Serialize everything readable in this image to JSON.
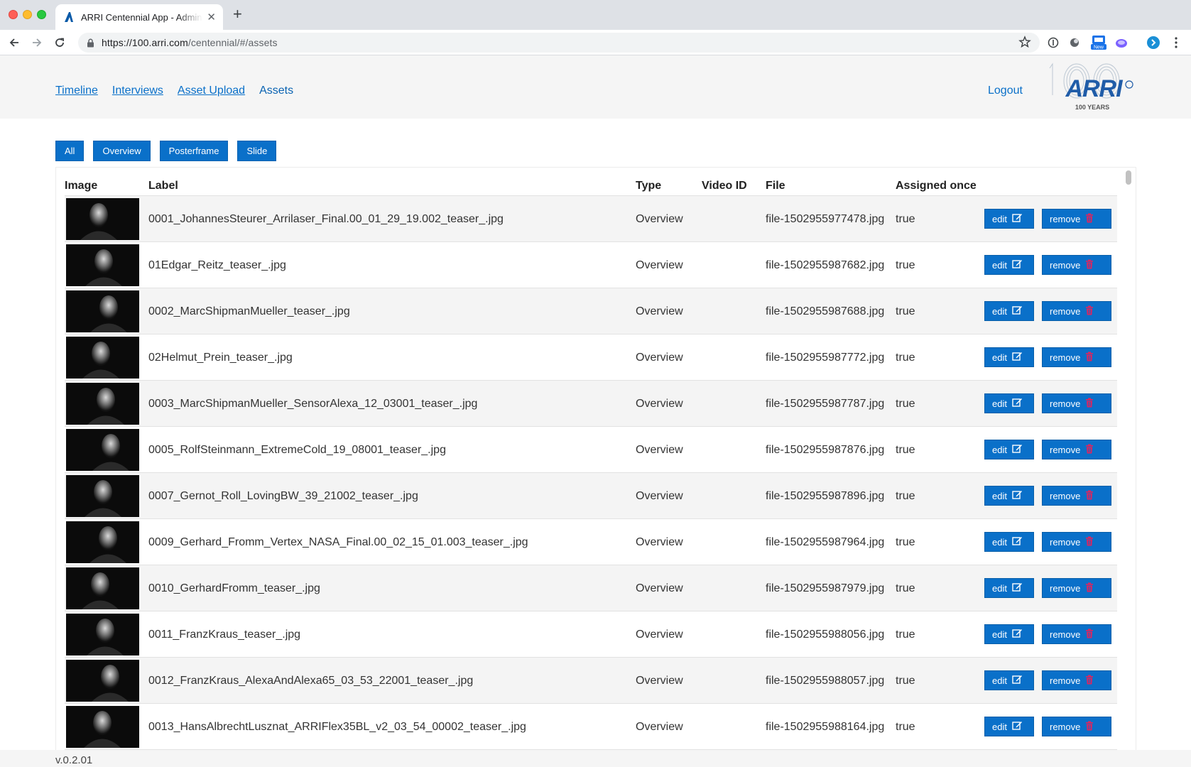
{
  "browser": {
    "tab_title": "ARRI Centennial App - Administration",
    "url_host": "https://100.arri.com",
    "url_path": "/centennial/#/assets",
    "ext_new_badge": "New"
  },
  "header": {
    "nav": [
      "Timeline",
      "Interviews",
      "Asset Upload",
      "Assets"
    ],
    "logout": "Logout",
    "logo_text": "ARRI",
    "logo_sub": "100 YEARS"
  },
  "filters": [
    "All",
    "Overview",
    "Posterframe",
    "Slide"
  ],
  "table": {
    "columns": [
      "Image",
      "Label",
      "Type",
      "Video ID",
      "File",
      "Assigned once"
    ],
    "edit_label": "edit",
    "remove_label": "remove",
    "rows": [
      {
        "label": "0001_JohannesSteurer_Arrilaser_Final.00_01_29_19.002_teaser_.jpg",
        "type": "Overview",
        "video_id": "",
        "file": "file-1502955977478.jpg",
        "assigned": "true"
      },
      {
        "label": "01Edgar_Reitz_teaser_.jpg",
        "type": "Overview",
        "video_id": "",
        "file": "file-1502955987682.jpg",
        "assigned": "true"
      },
      {
        "label": "0002_MarcShipmanMueller_teaser_.jpg",
        "type": "Overview",
        "video_id": "",
        "file": "file-1502955987688.jpg",
        "assigned": "true"
      },
      {
        "label": "02Helmut_Prein_teaser_.jpg",
        "type": "Overview",
        "video_id": "",
        "file": "file-1502955987772.jpg",
        "assigned": "true"
      },
      {
        "label": "0003_MarcShipmanMueller_SensorAlexa_12_03001_teaser_.jpg",
        "type": "Overview",
        "video_id": "",
        "file": "file-1502955987787.jpg",
        "assigned": "true"
      },
      {
        "label": "0005_RolfSteinmann_ExtremeCold_19_08001_teaser_.jpg",
        "type": "Overview",
        "video_id": "",
        "file": "file-1502955987876.jpg",
        "assigned": "true"
      },
      {
        "label": "0007_Gernot_Roll_LovingBW_39_21002_teaser_.jpg",
        "type": "Overview",
        "video_id": "",
        "file": "file-1502955987896.jpg",
        "assigned": "true"
      },
      {
        "label": "0009_Gerhard_Fromm_Vertex_NASA_Final.00_02_15_01.003_teaser_.jpg",
        "type": "Overview",
        "video_id": "",
        "file": "file-1502955987964.jpg",
        "assigned": "true"
      },
      {
        "label": "0010_GerhardFromm_teaser_.jpg",
        "type": "Overview",
        "video_id": "",
        "file": "file-1502955987979.jpg",
        "assigned": "true"
      },
      {
        "label": "0011_FranzKraus_teaser_.jpg",
        "type": "Overview",
        "video_id": "",
        "file": "file-1502955988056.jpg",
        "assigned": "true"
      },
      {
        "label": "0012_FranzKraus_AlexaAndAlexa65_03_53_22001_teaser_.jpg",
        "type": "Overview",
        "video_id": "",
        "file": "file-1502955988057.jpg",
        "assigned": "true"
      },
      {
        "label": "0013_HansAlbrechtLusznat_ARRIFlex35BL_v2_03_54_00002_teaser_.jpg",
        "type": "Overview",
        "video_id": "",
        "file": "file-1502955988164.jpg",
        "assigned": "true"
      }
    ]
  },
  "footer": {
    "version": "v.0.2.01"
  },
  "colors": {
    "primary": "#0a70c9",
    "trash": "#e0245e",
    "header_bg": "#f5f5f5"
  }
}
